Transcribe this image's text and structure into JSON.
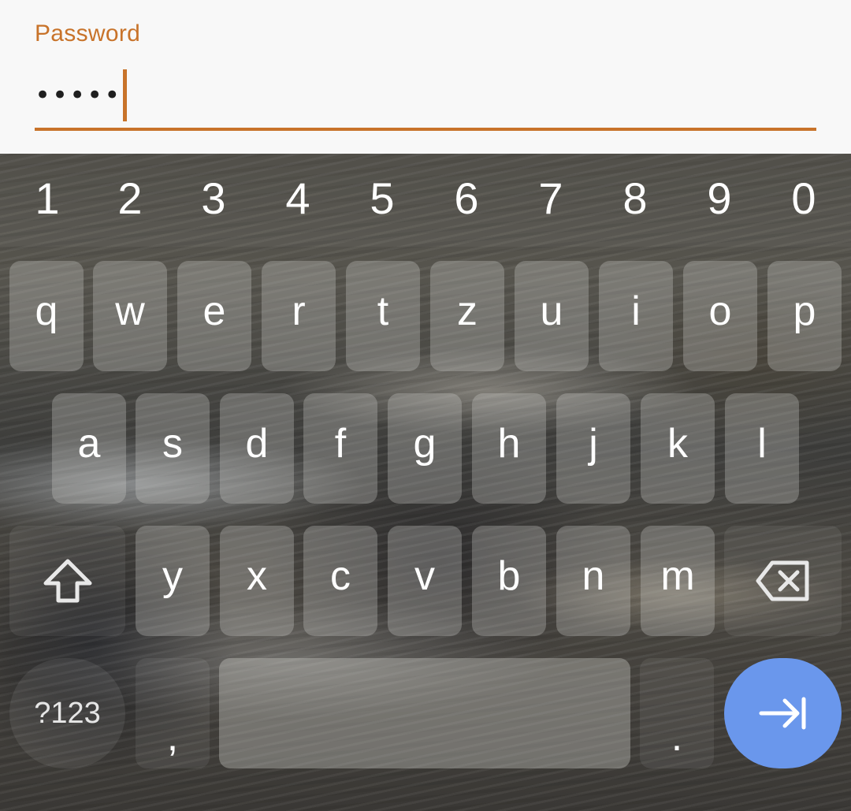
{
  "password_field": {
    "label": "Password",
    "masked_value": "•••••",
    "accent_color": "#c8732a"
  },
  "keyboard": {
    "number_row": [
      "1",
      "2",
      "3",
      "4",
      "5",
      "6",
      "7",
      "8",
      "9",
      "0"
    ],
    "letter_rows": [
      [
        "q",
        "w",
        "e",
        "r",
        "t",
        "z",
        "u",
        "i",
        "o",
        "p"
      ],
      [
        "a",
        "s",
        "d",
        "f",
        "g",
        "h",
        "j",
        "k",
        "l"
      ],
      [
        "y",
        "x",
        "c",
        "v",
        "b",
        "n",
        "m"
      ]
    ],
    "shift_icon": "shift-arrow-icon",
    "backspace_icon": "backspace-icon",
    "symbols_label": "?123",
    "comma_label": ",",
    "period_label": ".",
    "enter_icon": "next-field-tab-icon",
    "enter_color": "#6a97ec"
  }
}
